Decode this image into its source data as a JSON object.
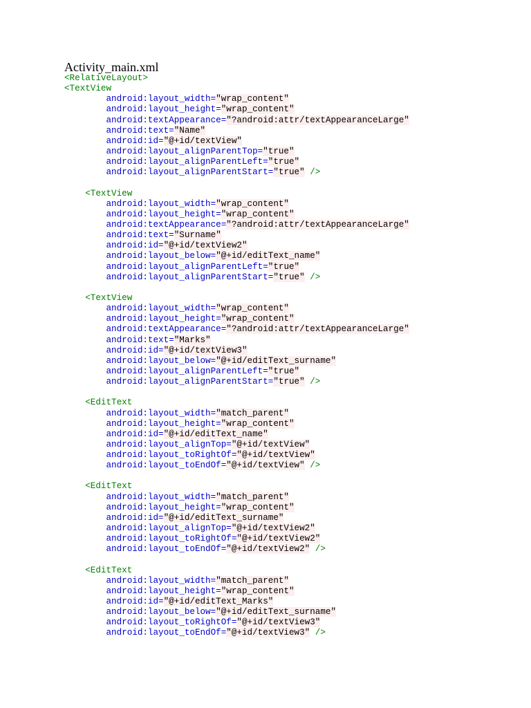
{
  "document": {
    "title": "Activity_main.xml",
    "code_lines": [
      {
        "indent": 0,
        "tag": "<RelativeLayout>"
      },
      {
        "indent": 0,
        "tag": "<TextView"
      },
      {
        "indent": 2,
        "attr": "android:layout_width",
        "value": "\"wrap_content\""
      },
      {
        "indent": 2,
        "attr": "android:layout_height",
        "value": "\"wrap_content\""
      },
      {
        "indent": 2,
        "attr": "android:textAppearance",
        "value": "\"?android:attr/textAppearanceLarge\""
      },
      {
        "indent": 2,
        "attr": "android:text",
        "value": "\"Name\""
      },
      {
        "indent": 2,
        "attr": "android:id",
        "value": "\"@+id/textView\""
      },
      {
        "indent": 2,
        "attr": "android:layout_alignParentTop",
        "value": "\"true\""
      },
      {
        "indent": 2,
        "attr": "android:layout_alignParentLeft",
        "value": "\"true\""
      },
      {
        "indent": 2,
        "attr": "android:layout_alignParentStart",
        "value": "\"true\"",
        "close": " />"
      },
      {
        "blank": true
      },
      {
        "indent": 1,
        "tag": "<TextView"
      },
      {
        "indent": 2,
        "attr": "android:layout_width",
        "value": "\"wrap_content\""
      },
      {
        "indent": 2,
        "attr": "android:layout_height",
        "value": "\"wrap_content\""
      },
      {
        "indent": 2,
        "attr": "android:textAppearance",
        "value": "\"?android:attr/textAppearanceLarge\""
      },
      {
        "indent": 2,
        "attr": "android:text",
        "value": "\"Surname\""
      },
      {
        "indent": 2,
        "attr": "android:id",
        "value": "\"@+id/textView2\""
      },
      {
        "indent": 2,
        "attr": "android:layout_below",
        "value": "\"@+id/editText_name\""
      },
      {
        "indent": 2,
        "attr": "android:layout_alignParentLeft",
        "value": "\"true\""
      },
      {
        "indent": 2,
        "attr": "android:layout_alignParentStart",
        "value": "\"true\"",
        "close": " />"
      },
      {
        "blank": true
      },
      {
        "indent": 1,
        "tag": "<TextView"
      },
      {
        "indent": 2,
        "attr": "android:layout_width",
        "value": "\"wrap_content\""
      },
      {
        "indent": 2,
        "attr": "android:layout_height",
        "value": "\"wrap_content\""
      },
      {
        "indent": 2,
        "attr": "android:textAppearance",
        "value": "\"?android:attr/textAppearanceLarge\""
      },
      {
        "indent": 2,
        "attr": "android:text",
        "value": "\"Marks\""
      },
      {
        "indent": 2,
        "attr": "android:id",
        "value": "\"@+id/textView3\""
      },
      {
        "indent": 2,
        "attr": "android:layout_below",
        "value": "\"@+id/editText_surname\""
      },
      {
        "indent": 2,
        "attr": "android:layout_alignParentLeft",
        "value": "\"true\""
      },
      {
        "indent": 2,
        "attr": "android:layout_alignParentStart",
        "value": "\"true\"",
        "close": " />"
      },
      {
        "blank": true
      },
      {
        "indent": 1,
        "tag": "<EditText"
      },
      {
        "indent": 2,
        "attr": "android:layout_width",
        "value": "\"match_parent\""
      },
      {
        "indent": 2,
        "attr": "android:layout_height",
        "value": "\"wrap_content\""
      },
      {
        "indent": 2,
        "attr": "android:id",
        "value": "\"@+id/editText_name\""
      },
      {
        "indent": 2,
        "attr": "android:layout_alignTop",
        "value": "\"@+id/textView\""
      },
      {
        "indent": 2,
        "attr": "android:layout_toRightOf",
        "value": "\"@+id/textView\""
      },
      {
        "indent": 2,
        "attr": "android:layout_toEndOf",
        "value": "\"@+id/textView\"",
        "close": " />"
      },
      {
        "blank": true
      },
      {
        "indent": 1,
        "tag": "<EditText"
      },
      {
        "indent": 2,
        "attr": "android:layout_width",
        "value": "\"match_parent\""
      },
      {
        "indent": 2,
        "attr": "android:layout_height",
        "value": "\"wrap_content\""
      },
      {
        "indent": 2,
        "attr": "android:id",
        "value": "\"@+id/editText_surname\""
      },
      {
        "indent": 2,
        "attr": "android:layout_alignTop",
        "value": "\"@+id/textView2\""
      },
      {
        "indent": 2,
        "attr": "android:layout_toRightOf",
        "value": "\"@+id/textView2\""
      },
      {
        "indent": 2,
        "attr": "android:layout_toEndOf",
        "value": "\"@+id/textView2\"",
        "close": " />"
      },
      {
        "blank": true
      },
      {
        "indent": 1,
        "tag": "<EditText"
      },
      {
        "indent": 2,
        "attr": "android:layout_width",
        "value": "\"match_parent\""
      },
      {
        "indent": 2,
        "attr": "android:layout_height",
        "value": "\"wrap_content\""
      },
      {
        "indent": 2,
        "attr": "android:id",
        "value": "\"@+id/editText_Marks\""
      },
      {
        "indent": 2,
        "attr": "android:layout_below",
        "value": "\"@+id/editText_surname\""
      },
      {
        "indent": 2,
        "attr": "android:layout_toRightOf",
        "value": "\"@+id/textView3\""
      },
      {
        "indent": 2,
        "attr": "android:layout_toEndOf",
        "value": "\"@+id/textView3\"",
        "close": " />"
      }
    ]
  },
  "colors": {
    "tag": "#008000",
    "attribute": "#0000cc",
    "value_text": "#000000",
    "value_highlight": "#fdeeee"
  }
}
